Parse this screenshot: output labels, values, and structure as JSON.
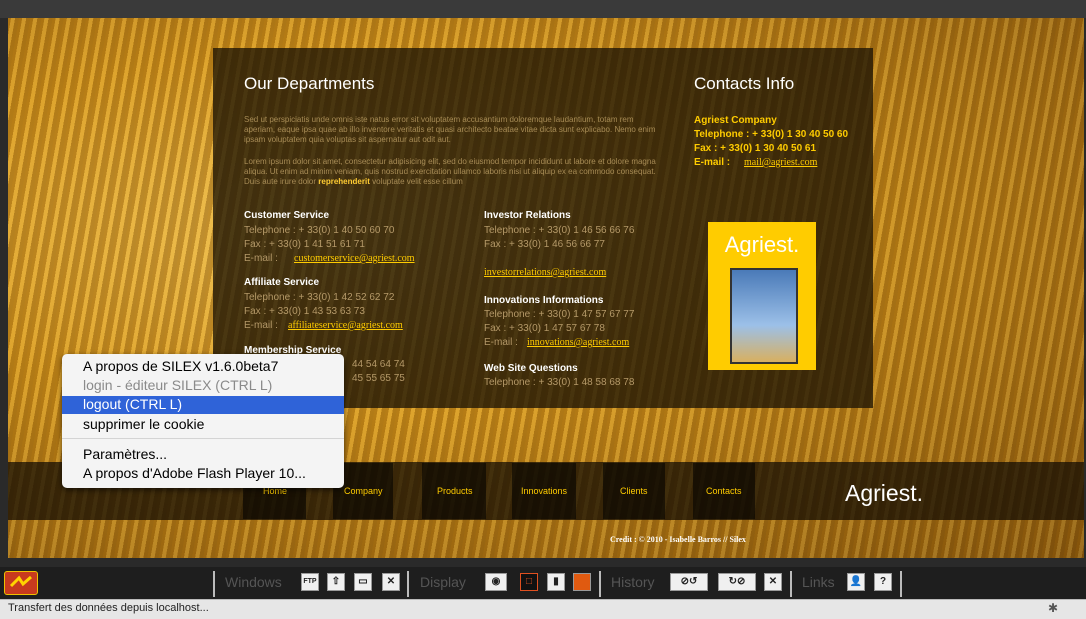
{
  "site": {
    "departments_title": "Our Departments",
    "lorem1": "Sed ut perspiciatis unde omnis iste natus error sit voluptatem accusantium doloremque laudantium, totam rem aperiam, eaque ipsa quae ab illo inventore veritatis et quasi architecto beatae vitae dicta sunt explicabo. Nemo enim ipsam voluptatem quia voluptas sit aspernatur aut odit aut.",
    "lorem2a": "Lorem ipsum dolor sit amet, consectetur adipisicing elit, sed do eiusmod tempor incididunt ut labore et dolore magna aliqua. Ut enim ad minim veniam, quis nostrud exercitation ullamco laboris nisi ut aliquip ex ea commodo consequat. Duis aute irure dolor",
    "lorem2_bold": "reprehenderit",
    "lorem2b": "voluptate velit esse cillum",
    "departments": [
      {
        "title": "Customer Service",
        "tel": "Telephone :  + 33(0)  1 40 50 60 70",
        "fax": "Fax :                + 33(0)  1 41 51 61 71",
        "email_label": "E-mail :",
        "email": "customerservice@agriest.com"
      },
      {
        "title": "Affiliate Service",
        "tel": "Telephone : + 33(0) 1 42 52 62 72",
        "fax": "Fax :                + 33(0) 1 43 53 63 73",
        "email_label": "E-mail :",
        "email": "affiliateservice@agriest.com"
      },
      {
        "title": "Membership Service",
        "tel": "44 54 64 74",
        "fax": "45 55 65 75"
      },
      {
        "title": "Investor Relations",
        "tel": "Telephone :  + 33(0)  1 46 56 66 76",
        "fax": "Fax :                + 33(0)  1 46 56 66 77",
        "email": "investorrelations@agriest.com"
      },
      {
        "title": "Innovations Informations",
        "tel": "Telephone :  + 33(0)  1 47 57 67 77",
        "fax": "Fax :                + 33(0)  1 47 57 67 78",
        "email_label": "E-mail :",
        "email": "innovations@agriest.com"
      },
      {
        "title": "Web Site Questions",
        "tel": "Telephone :  + 33(0)  1 48 58 68 78"
      }
    ],
    "contacts_title": "Contacts Info",
    "company": "Agriest Company",
    "company_tel": "Telephone :  + 33(0)  1 30 40 50 60",
    "company_fax": "Fax :           + 33(0)  1 30 40 50 61",
    "company_email_label": "E-mail :",
    "company_email": "mail@agriest.com",
    "logo_text": "Agriest.",
    "nav": [
      "Home",
      "Company",
      "Products",
      "Innovations",
      "Clients",
      "Contacts"
    ],
    "brand": "Agriest.",
    "credits": "Credit : © 2010 - Isabelle Barros // Silex"
  },
  "context_menu": {
    "items": [
      {
        "label": "A propos de SILEX v1.6.0beta7",
        "state": "normal"
      },
      {
        "label": "login - éditeur SILEX (CTRL   L)",
        "state": "disabled"
      },
      {
        "label": "logout (CTRL   L)",
        "state": "selected"
      },
      {
        "label": "supprimer le cookie",
        "state": "normal"
      },
      {
        "label": "Paramètres...",
        "state": "normal"
      },
      {
        "label": "A propos d'Adobe Flash Player 10...",
        "state": "normal"
      }
    ]
  },
  "toolbar": {
    "windows_label": "Windows",
    "display_label": "Display",
    "history_label": "History",
    "links_label": "Links",
    "ftp_label": "FTP",
    "help_label": "?"
  },
  "status": {
    "text": "Transfert des données depuis localhost..."
  }
}
